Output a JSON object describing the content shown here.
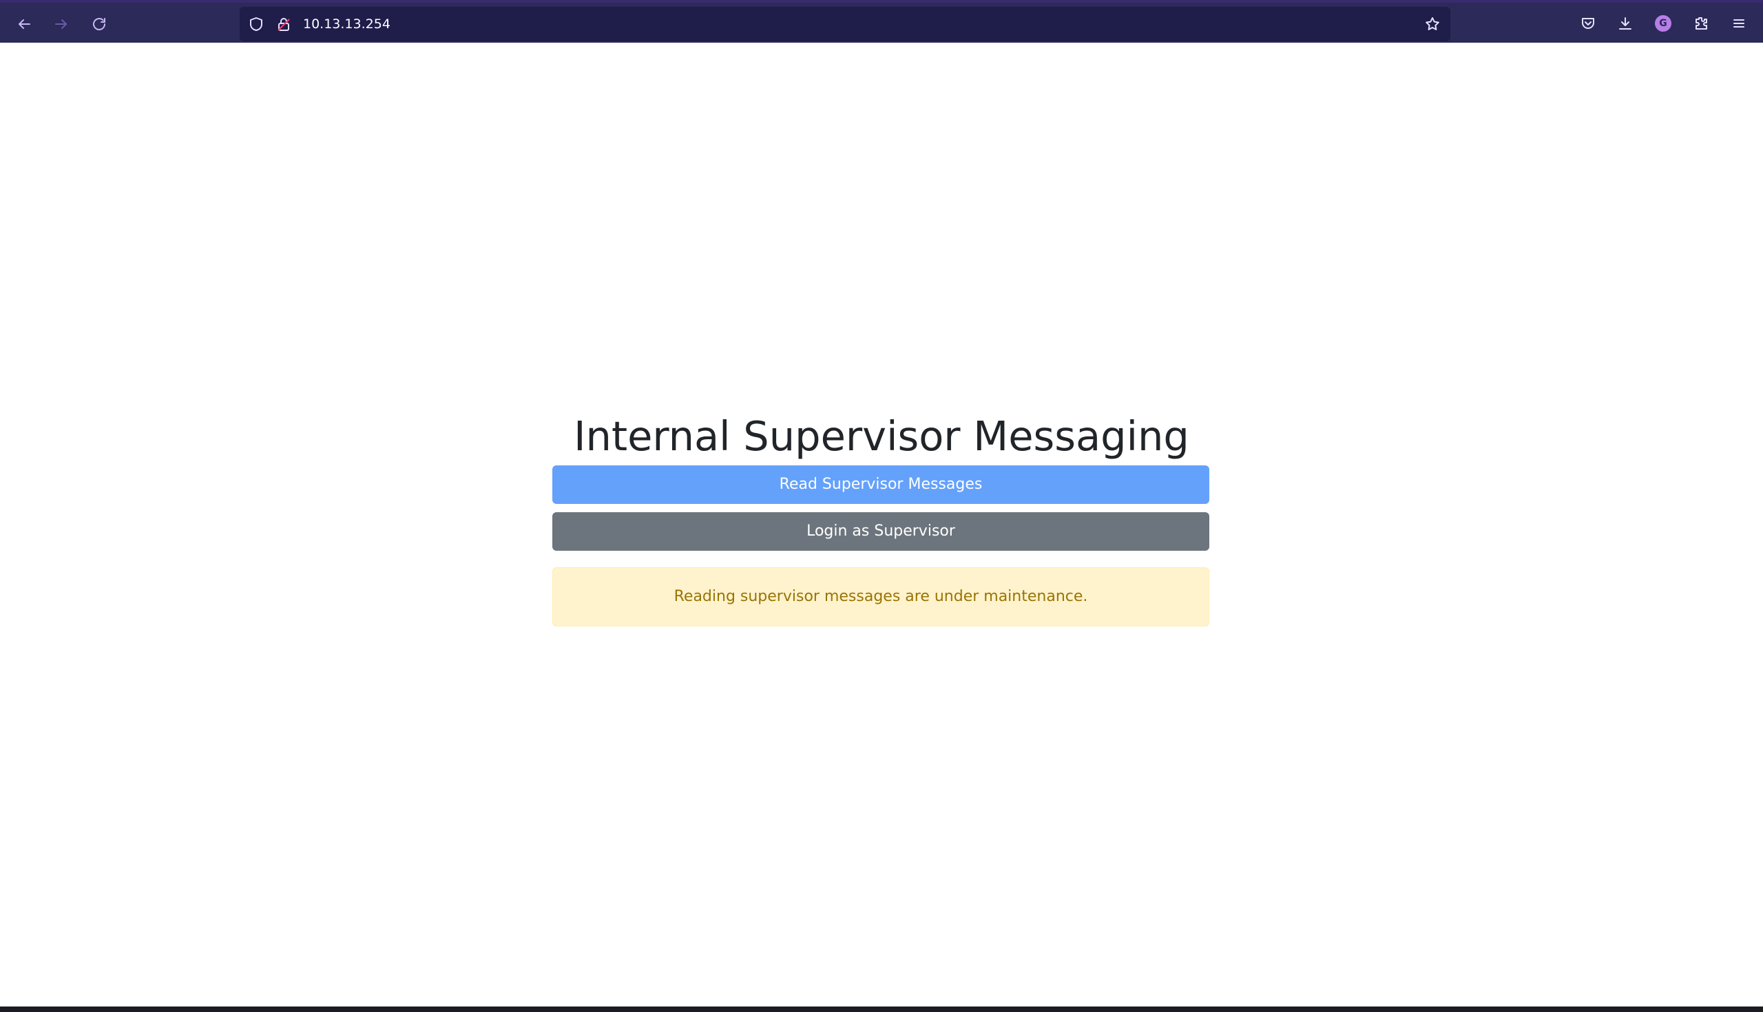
{
  "browser": {
    "url": "10.13.13.254",
    "profile_initial": "G",
    "accent_color": "#2b2a58"
  },
  "page": {
    "title": "Internal Supervisor Messaging",
    "read_button_label": "Read Supervisor Messages",
    "login_button_label": "Login as Supervisor",
    "alert_text": "Reading supervisor messages are under maintenance.",
    "colors": {
      "primary_button": "#64a1fb",
      "secondary_button": "#6c757d",
      "alert_background": "#fff3cd",
      "alert_text": "#997404"
    }
  },
  "icons": {
    "nav": [
      "back-arrow-icon",
      "forward-arrow-icon",
      "reload-icon"
    ],
    "urlbar": [
      "shield-icon",
      "lock-icon",
      "bookmark-star-icon"
    ],
    "toolbar": [
      "pocket-icon",
      "download-icon",
      "account-avatar",
      "extensions-icon",
      "menu-icon"
    ]
  }
}
